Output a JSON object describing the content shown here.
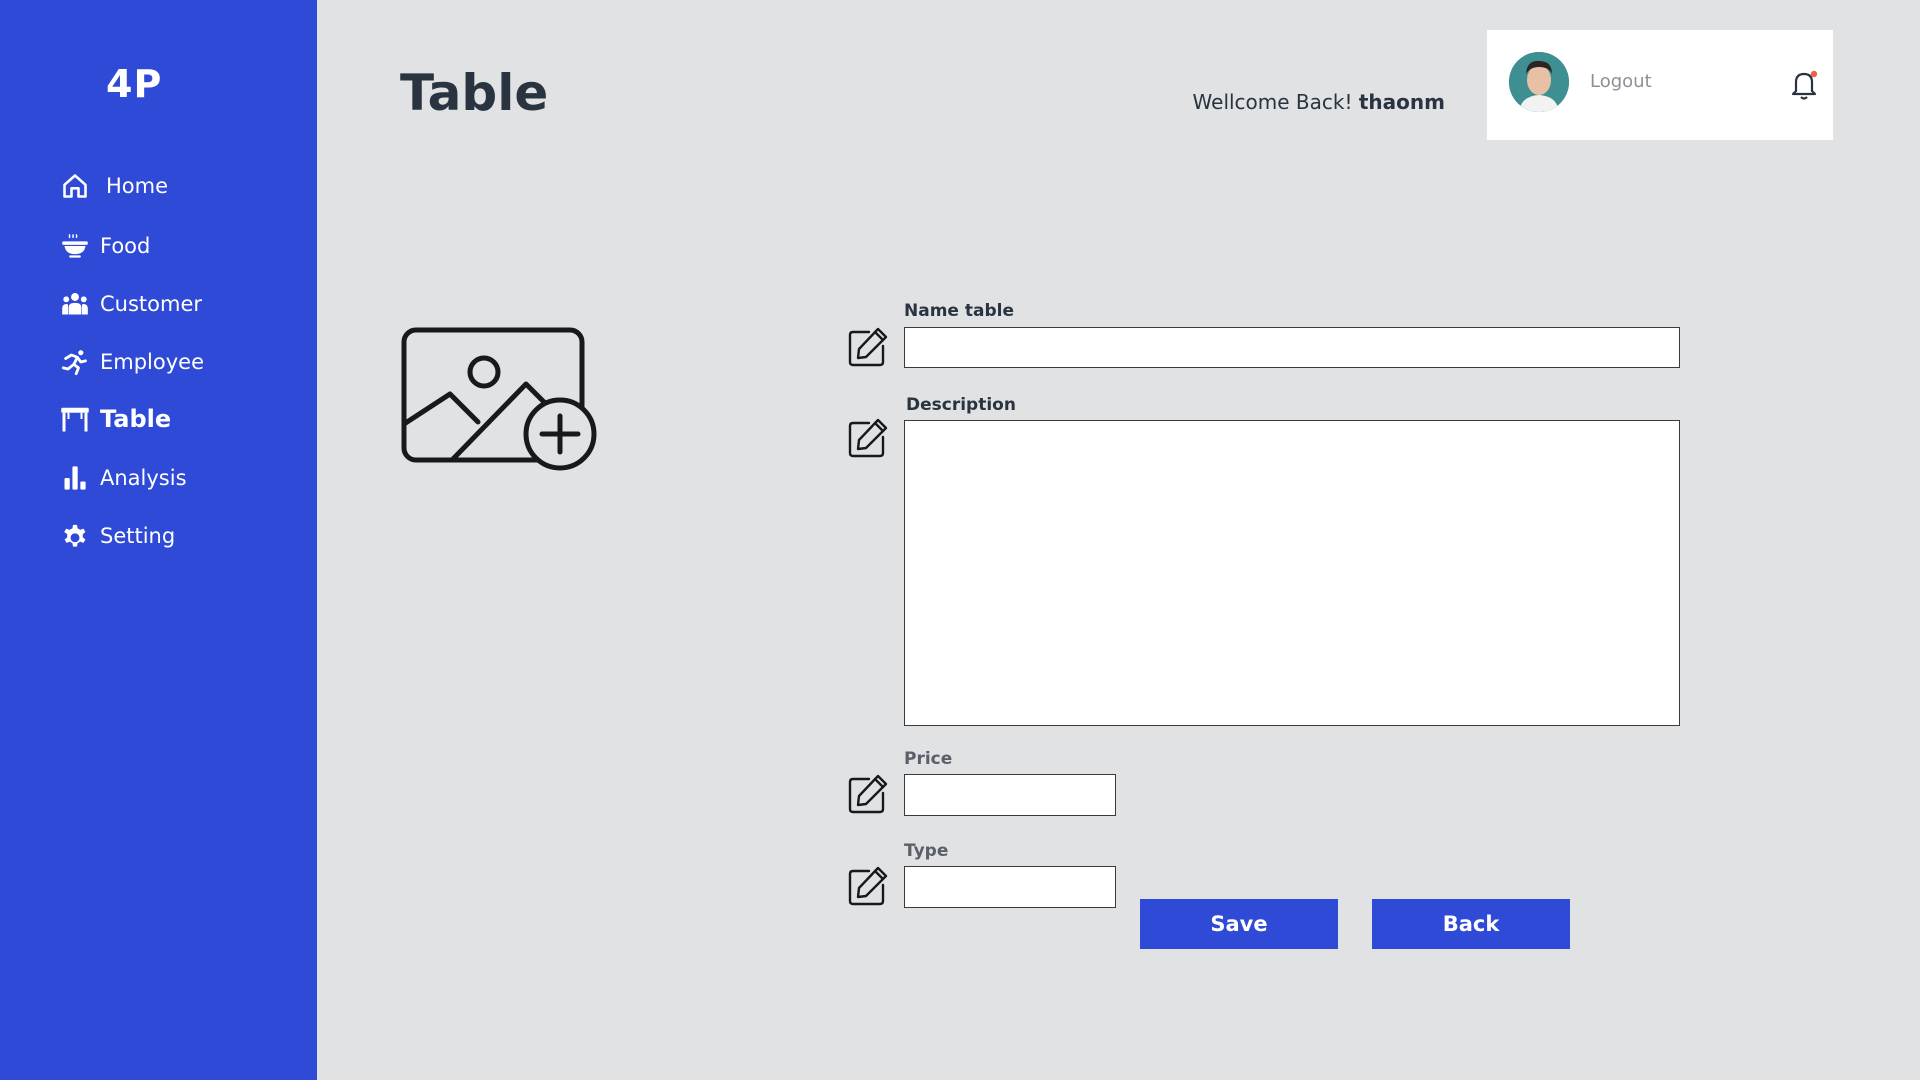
{
  "brand": {
    "logo": "4P",
    "accent": "#2f4ad6"
  },
  "sidebar": {
    "items": [
      {
        "label": "Home",
        "icon": "home-icon"
      },
      {
        "label": "Food",
        "icon": "food-bowl-icon"
      },
      {
        "label": "Customer",
        "icon": "users-icon"
      },
      {
        "label": "Employee",
        "icon": "employee-run-icon"
      },
      {
        "label": "Table",
        "icon": "table-icon",
        "active": true
      },
      {
        "label": "Analysis",
        "icon": "bar-chart-icon"
      },
      {
        "label": "Setting",
        "icon": "gear-icon"
      }
    ]
  },
  "header": {
    "title": "Table",
    "welcome_text": "Wellcome Back!",
    "username": "thaonm"
  },
  "user_panel": {
    "logout_label": "Logout",
    "notification_icon": "bell-icon",
    "notification_dot_color": "#e8624a"
  },
  "form": {
    "image_icon": "image-add-icon",
    "name_label": "Name table",
    "name_value": "",
    "description_label": "Description",
    "description_value": "",
    "price_label": "Price",
    "price_value": "",
    "type_label": "Type",
    "type_value": "",
    "save_label": "Save",
    "back_label": "Back"
  }
}
